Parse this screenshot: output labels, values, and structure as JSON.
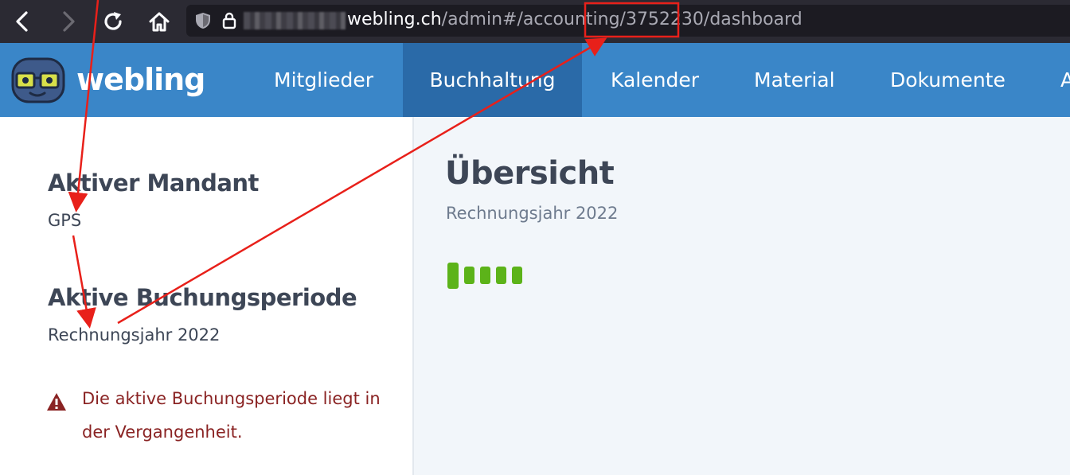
{
  "browser": {
    "url_host": "webling.ch",
    "url_path": "/admin#/accounting/3752230/dashboard"
  },
  "app": {
    "logo_text": "webling",
    "nav": [
      {
        "label": "Mitglieder"
      },
      {
        "label": "Buchhaltung",
        "active": true
      },
      {
        "label": "Kalender"
      },
      {
        "label": "Material"
      },
      {
        "label": "Dokumente"
      },
      {
        "label": "A"
      }
    ]
  },
  "sidebar": {
    "client_heading": "Aktiver Mandant",
    "client_value": "GPS",
    "period_heading": "Aktive Buchungsperiode",
    "period_value": "Rechnungsjahr 2022",
    "warning": "Die aktive Buchungsperiode liegt in der Vergangenheit."
  },
  "main": {
    "title": "Übersicht",
    "subtitle": "Rechnungsjahr 2022"
  },
  "colors": {
    "header_bg": "#3a86c8",
    "active_nav_bg": "#2a6aa8",
    "loader_green": "#5cb319",
    "warning_red": "#8a2323",
    "annotation_red": "#e8201a"
  },
  "icons": [
    "back-arrow-icon",
    "forward-arrow-icon",
    "reload-icon",
    "home-icon",
    "shield-icon",
    "lock-icon",
    "logo-mascot-icon",
    "warning-triangle-icon"
  ]
}
